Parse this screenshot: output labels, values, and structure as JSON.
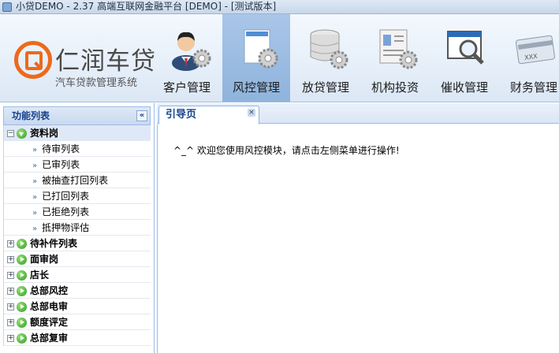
{
  "window": {
    "title": "小贷DEMO - 2.37 高端互联网金融平台 [DEMO] - [测试版本]"
  },
  "brand": {
    "name": "仁润车贷",
    "subtitle": "汽车贷款管理系统"
  },
  "nav": [
    {
      "label": "客户管理",
      "icon": "customer-icon",
      "active": false
    },
    {
      "label": "风控管理",
      "icon": "risk-control-icon",
      "active": true
    },
    {
      "label": "放贷管理",
      "icon": "loan-database-icon",
      "active": false
    },
    {
      "label": "机构投资",
      "icon": "institution-icon",
      "active": false
    },
    {
      "label": "催收管理",
      "icon": "collection-icon",
      "active": false
    },
    {
      "label": "财务管理",
      "icon": "finance-card-icon",
      "active": false
    }
  ],
  "sidebar": {
    "title": "功能列表",
    "collapse": "«",
    "groups": [
      {
        "label": "资料岗",
        "expanded": true,
        "items": [
          "待审列表",
          "已审列表",
          "被抽查打回列表",
          "已打回列表",
          "已拒绝列表",
          "抵押物评估"
        ]
      },
      {
        "label": "待补件列表",
        "expanded": false
      },
      {
        "label": "面审岗",
        "expanded": false
      },
      {
        "label": "店长",
        "expanded": false
      },
      {
        "label": "总部风控",
        "expanded": false
      },
      {
        "label": "总部电审",
        "expanded": false
      },
      {
        "label": "额度评定",
        "expanded": false
      },
      {
        "label": "总部复审",
        "expanded": false
      }
    ]
  },
  "tabs": [
    {
      "label": "引导页",
      "close": "×"
    }
  ],
  "content": {
    "welcome": "^_^ 欢迎您使用风控模块，请点击左侧菜单进行操作!"
  },
  "colors": {
    "accent": "#15428b",
    "brand_orange": "#ec6a1c",
    "active_nav": "#9fc0e6"
  }
}
